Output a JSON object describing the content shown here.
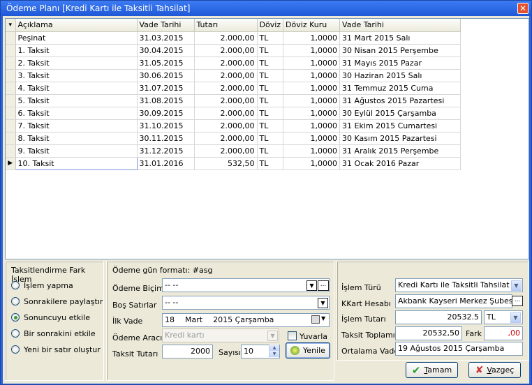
{
  "window": {
    "title": "Ödeme Planı [Kredi Kartı ile Taksitli Tahsilat]",
    "close_glyph": "✕"
  },
  "grid": {
    "indicator_glyph": "▾",
    "current_glyph": "▶",
    "columns": [
      "Açıklama",
      "Vade Tarihi",
      "Tutarı",
      "Döviz",
      "Döviz Kuru",
      "Vade Tarihi"
    ],
    "rows": [
      [
        "Peşinat",
        "31.03.2015",
        "2.000,00",
        "TL",
        "1,0000",
        "31 Mart 2015 Salı"
      ],
      [
        "1. Taksit",
        "30.04.2015",
        "2.000,00",
        "TL",
        "1,0000",
        "30 Nisan 2015 Perşembe"
      ],
      [
        "2. Taksit",
        "31.05.2015",
        "2.000,00",
        "TL",
        "1,0000",
        "31 Mayıs 2015 Pazar"
      ],
      [
        "3. Taksit",
        "30.06.2015",
        "2.000,00",
        "TL",
        "1,0000",
        "30 Haziran 2015 Salı"
      ],
      [
        "4. Taksit",
        "31.07.2015",
        "2.000,00",
        "TL",
        "1,0000",
        "31 Temmuz 2015 Cuma"
      ],
      [
        "5. Taksit",
        "31.08.2015",
        "2.000,00",
        "TL",
        "1,0000",
        "31 Ağustos 2015 Pazartesi"
      ],
      [
        "6. Taksit",
        "30.09.2015",
        "2.000,00",
        "TL",
        "1,0000",
        "30 Eylül 2015 Çarşamba"
      ],
      [
        "7. Taksit",
        "31.10.2015",
        "2.000,00",
        "TL",
        "1,0000",
        "31 Ekim 2015 Cumartesi"
      ],
      [
        "8. Taksit",
        "30.11.2015",
        "2.000,00",
        "TL",
        "1,0000",
        "30 Kasım 2015 Pazartesi"
      ],
      [
        "9. Taksit",
        "31.12.2015",
        "2.000,00",
        "TL",
        "1,0000",
        "31 Aralık 2015 Perşembe"
      ],
      [
        "10. Taksit",
        "31.01.2016",
        "532,50",
        "TL",
        "1,0000",
        "31 Ocak 2016 Pazar"
      ]
    ],
    "current_row": 10
  },
  "fark_panel": {
    "title": "Taksitlendirme Fark İşlem",
    "options": [
      "İşlem yapma",
      "Sonrakilere paylaştır",
      "Sonuncuyu etkile",
      "Bir sonrakini etkile",
      "Yeni bir satır oluştur"
    ],
    "selected": 2
  },
  "plan_panel": {
    "title": "Ödeme gün formatı: #asg",
    "odeme_bicimi_label": "Ödeme Biçimi",
    "odeme_bicimi_value": "-- --",
    "bos_satirlar_label": "Boş Satırlar",
    "bos_satirlar_value": "-- --",
    "ilk_vade_label": "İlk Vade",
    "ilk_vade_day": "18",
    "ilk_vade_month": "Mart",
    "ilk_vade_rest": "2015 Çarşamba",
    "odeme_araci_label": "Ödeme Aracı",
    "odeme_araci_value": "Kredi kartı",
    "yuvarla_label": "Yuvarla",
    "taksit_tutari_label": "Taksit Tutarı",
    "taksit_tutari_value": "2000",
    "sayisi_label": "Sayısı",
    "sayisi_value": "10",
    "yenile_label": "Yenile",
    "ellipsis": "...",
    "dd_glyph": "▼",
    "spin_up": "▲",
    "spin_down": "▼"
  },
  "right_panel": {
    "islem_turu_label": "İşlem Türü",
    "islem_turu_value": "Kredi Kartı ile Taksitli Tahsilat",
    "kkart_label": "KKart Hesabı",
    "kkart_value": "Akbank Kayseri Merkez Şubesi TL",
    "islem_tutari_label": "İşlem Tutarı",
    "islem_tutari_value": "20532.5",
    "currency": "TL",
    "taksit_toplami_label": "Taksit Toplamı",
    "taksit_toplami_value": "20532,50",
    "fark_label": "Fark",
    "fark_value": ",00",
    "ortalama_vade_label": "Ortalama Vade",
    "ortalama_vade_value": "19 Ağustos 2015 Çarşamba"
  },
  "buttons": {
    "ok_label_u": "T",
    "ok_label_rest": "amam",
    "cancel_label_u": "V",
    "cancel_label_rest": "azgeç"
  },
  "colors": {
    "title_bar": "#2b63d8",
    "fark_value": "#cc0000",
    "ok_icon": "#2e9e2e",
    "cancel_icon": "#d03030"
  }
}
